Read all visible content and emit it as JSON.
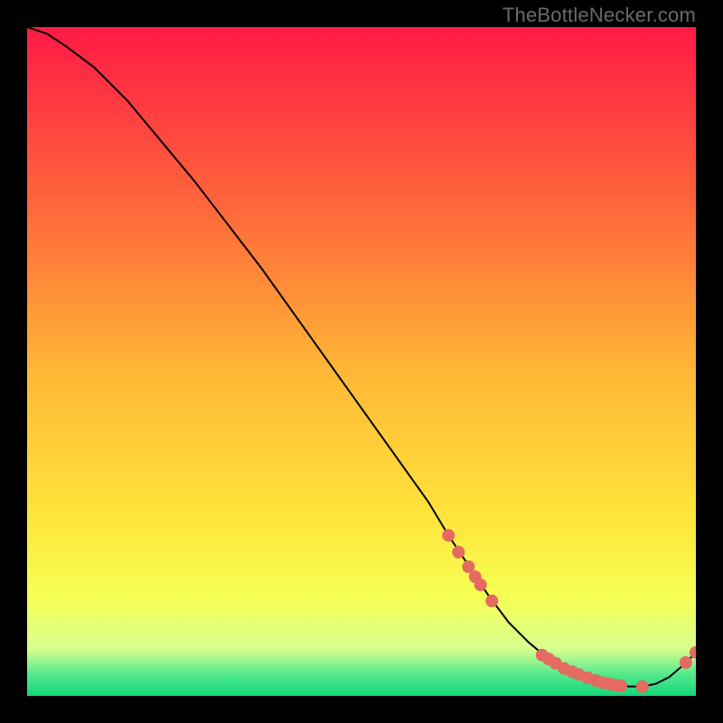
{
  "watermark": "TheBottleNecker.com",
  "gradient": {
    "top": "#ff1a46",
    "mid1": "#ff6a3a",
    "mid2": "#ffb836",
    "mid3": "#ffe23a",
    "mid4": "#f6ff52",
    "band": "#d7ff8f",
    "green1": "#4de88c",
    "green2": "#16d67a"
  },
  "curve_color": "#000000",
  "marker_color": "#e46a62",
  "marker_radius": 7,
  "chart_data": {
    "type": "line",
    "title": "",
    "xlabel": "",
    "ylabel": "",
    "xlim": [
      0,
      100
    ],
    "ylim": [
      0,
      100
    ],
    "series": [
      {
        "name": "curve",
        "x": [
          0,
          3,
          6,
          10,
          15,
          20,
          25,
          30,
          35,
          40,
          45,
          50,
          55,
          60,
          63,
          66,
          69,
          72,
          75,
          78,
          80,
          82,
          84,
          86,
          88,
          90,
          92,
          94,
          96,
          98,
          100
        ],
        "y": [
          100,
          99,
          97,
          94,
          89,
          83,
          77,
          70.5,
          64,
          57,
          50,
          43,
          36,
          29,
          24,
          19.5,
          15,
          11,
          8,
          5.5,
          4.2,
          3.2,
          2.5,
          2.0,
          1.6,
          1.4,
          1.4,
          1.8,
          2.8,
          4.5,
          6.5
        ]
      }
    ],
    "markers": [
      {
        "x": 63.0,
        "y": 24.0
      },
      {
        "x": 64.5,
        "y": 21.5
      },
      {
        "x": 66.0,
        "y": 19.3
      },
      {
        "x": 67.0,
        "y": 17.8
      },
      {
        "x": 67.8,
        "y": 16.6
      },
      {
        "x": 69.5,
        "y": 14.2
      },
      {
        "x": 77.0,
        "y": 6.1
      },
      {
        "x": 78.0,
        "y": 5.5
      },
      {
        "x": 79.0,
        "y": 4.9
      },
      {
        "x": 80.3,
        "y": 4.1
      },
      {
        "x": 81.5,
        "y": 3.6
      },
      {
        "x": 82.5,
        "y": 3.2
      },
      {
        "x": 83.8,
        "y": 2.7
      },
      {
        "x": 85.0,
        "y": 2.3
      },
      {
        "x": 86.0,
        "y": 2.0
      },
      {
        "x": 87.0,
        "y": 1.8
      },
      {
        "x": 88.0,
        "y": 1.6
      },
      {
        "x": 88.8,
        "y": 1.5
      },
      {
        "x": 92.0,
        "y": 1.4
      },
      {
        "x": 98.5,
        "y": 5.0
      },
      {
        "x": 100.0,
        "y": 6.5
      }
    ]
  }
}
